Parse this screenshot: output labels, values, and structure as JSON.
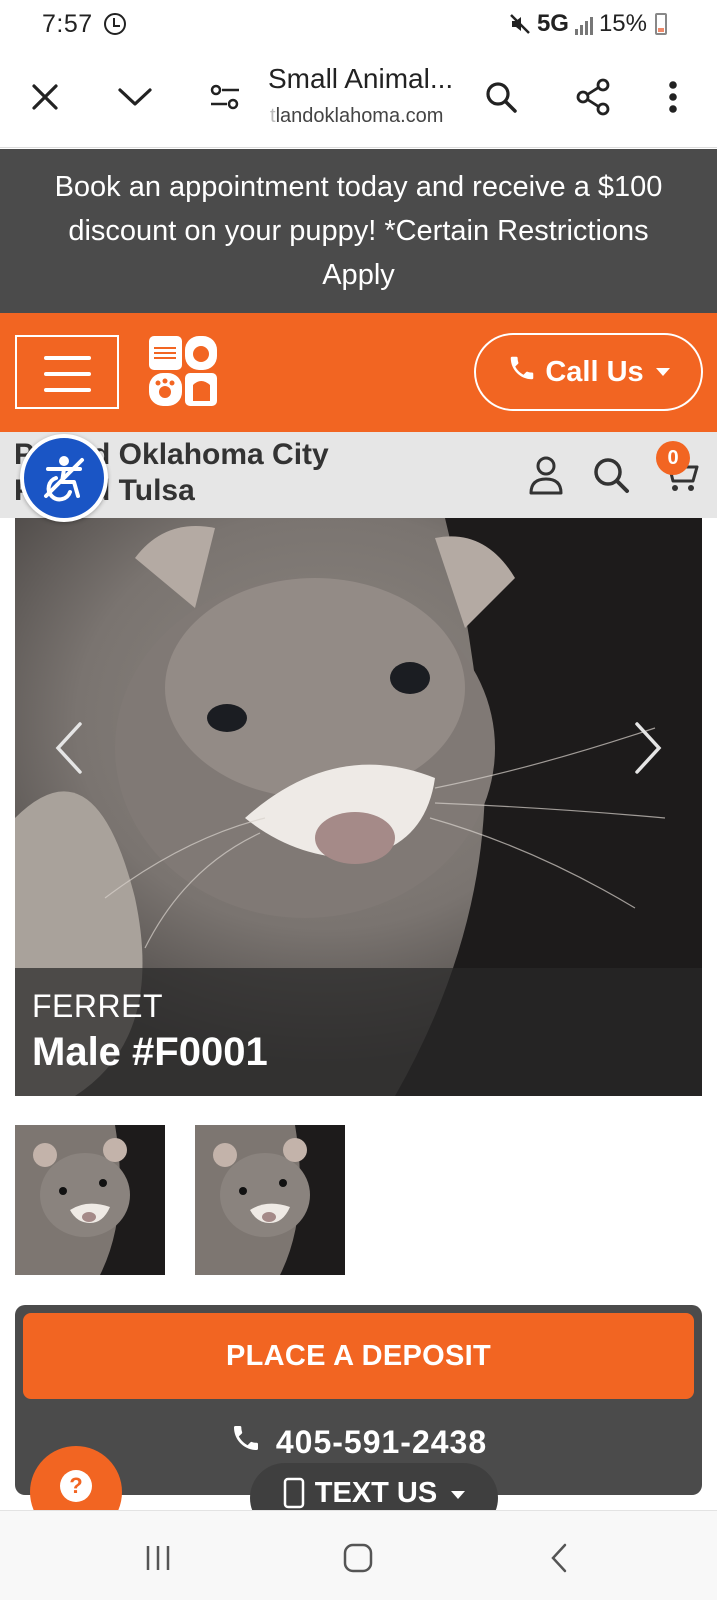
{
  "status_bar": {
    "time": "7:57",
    "network": "5G",
    "battery": "15%"
  },
  "browser": {
    "page_title": "Small Animal...",
    "url": "landoklahoma.com",
    "url_faded_prefix": "t"
  },
  "promo": {
    "text": "Book an appointment today and receive a $100 discount on your puppy! *Certain Restrictions Apply"
  },
  "header": {
    "call_label": "Call Us",
    "colors": {
      "brand_orange": "#f26522",
      "dark_gray": "#4b4b4b"
    }
  },
  "locations": {
    "line1_lead": "P",
    "line1_rest": "d Oklahoma City",
    "line2_lead": "P",
    "line2_rest": "d Tulsa"
  },
  "cart": {
    "count": "0"
  },
  "listing": {
    "animal_type": "FERRET",
    "name": "Male #F0001"
  },
  "actions": {
    "deposit_label": "PLACE A DEPOSIT",
    "phone": "405-591-2438",
    "text_us_label": "TEXT US",
    "help_label": "?"
  },
  "icons": [
    "close-icon",
    "chevron-down-icon",
    "tune-icon",
    "search-icon",
    "share-icon",
    "more-vert-icon",
    "menu-icon",
    "phone-icon",
    "accessibility-icon",
    "user-icon",
    "cart-icon",
    "chevron-left-icon",
    "chevron-right-icon",
    "mobile-phone-icon",
    "help-icon",
    "recents-icon",
    "home-icon",
    "back-icon"
  ]
}
